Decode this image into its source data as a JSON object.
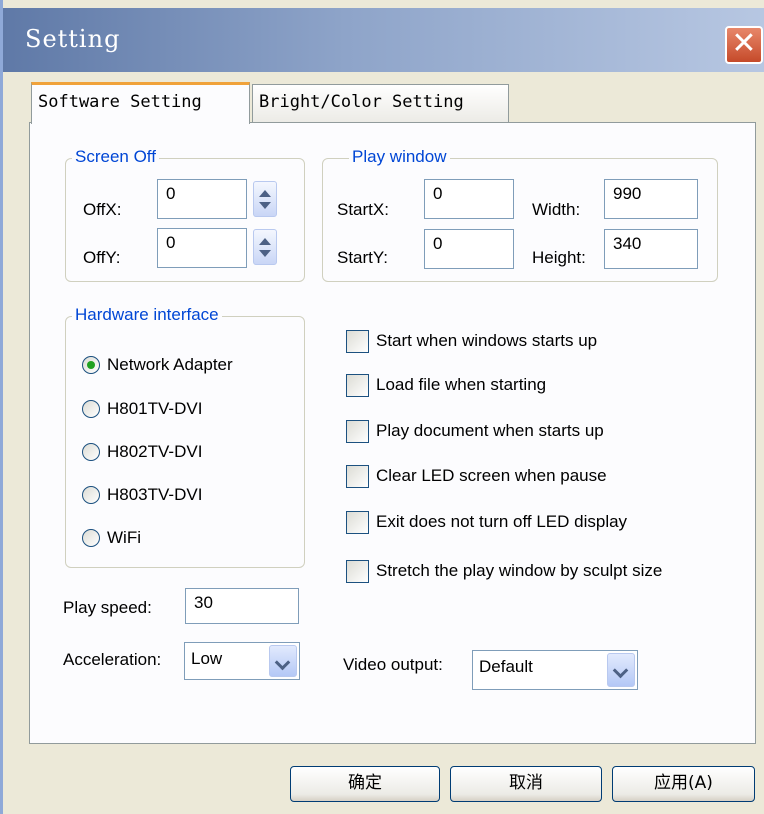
{
  "window": {
    "title": "Setting",
    "close_glyph": "✕"
  },
  "tabs": [
    {
      "label": "Software Setting",
      "selected": true
    },
    {
      "label": "Bright/Color Setting",
      "selected": false
    }
  ],
  "screen_off": {
    "legend": "Screen Off",
    "offx_label": "OffX:",
    "offx_value": "0",
    "offy_label": "OffY:",
    "offy_value": "0"
  },
  "play_window": {
    "legend": "Play window",
    "startx_label": "StartX:",
    "startx_value": "0",
    "starty_label": "StartY:",
    "starty_value": "0",
    "width_label": "Width:",
    "width_value": "990",
    "height_label": "Height:",
    "height_value": "340"
  },
  "hardware_interface": {
    "legend": "Hardware interface",
    "options": [
      "Network Adapter",
      "H801TV-DVI",
      "H802TV-DVI",
      "H803TV-DVI",
      "WiFi"
    ],
    "selected": "Network Adapter"
  },
  "checkboxes": [
    {
      "label": "Start when windows starts up",
      "checked": false
    },
    {
      "label": "Load file when starting",
      "checked": false
    },
    {
      "label": "Play document when starts up",
      "checked": false
    },
    {
      "label": "Clear LED screen when pause",
      "checked": false
    },
    {
      "label": "Exit does not turn off LED display",
      "checked": false
    },
    {
      "label": "Stretch the play window by  sculpt size",
      "checked": false
    }
  ],
  "play_speed": {
    "label": "Play speed:",
    "value": "30"
  },
  "acceleration": {
    "label": "Acceleration:",
    "value": "Low"
  },
  "video_output": {
    "label": "Video output:",
    "value": "Default"
  },
  "buttons": {
    "ok": "确定",
    "cancel": "取消",
    "apply": "应用(A)"
  },
  "colors": {
    "legend": "#0046d5",
    "titlebar": "#6d86b2",
    "radio_selected": "#21a121"
  }
}
